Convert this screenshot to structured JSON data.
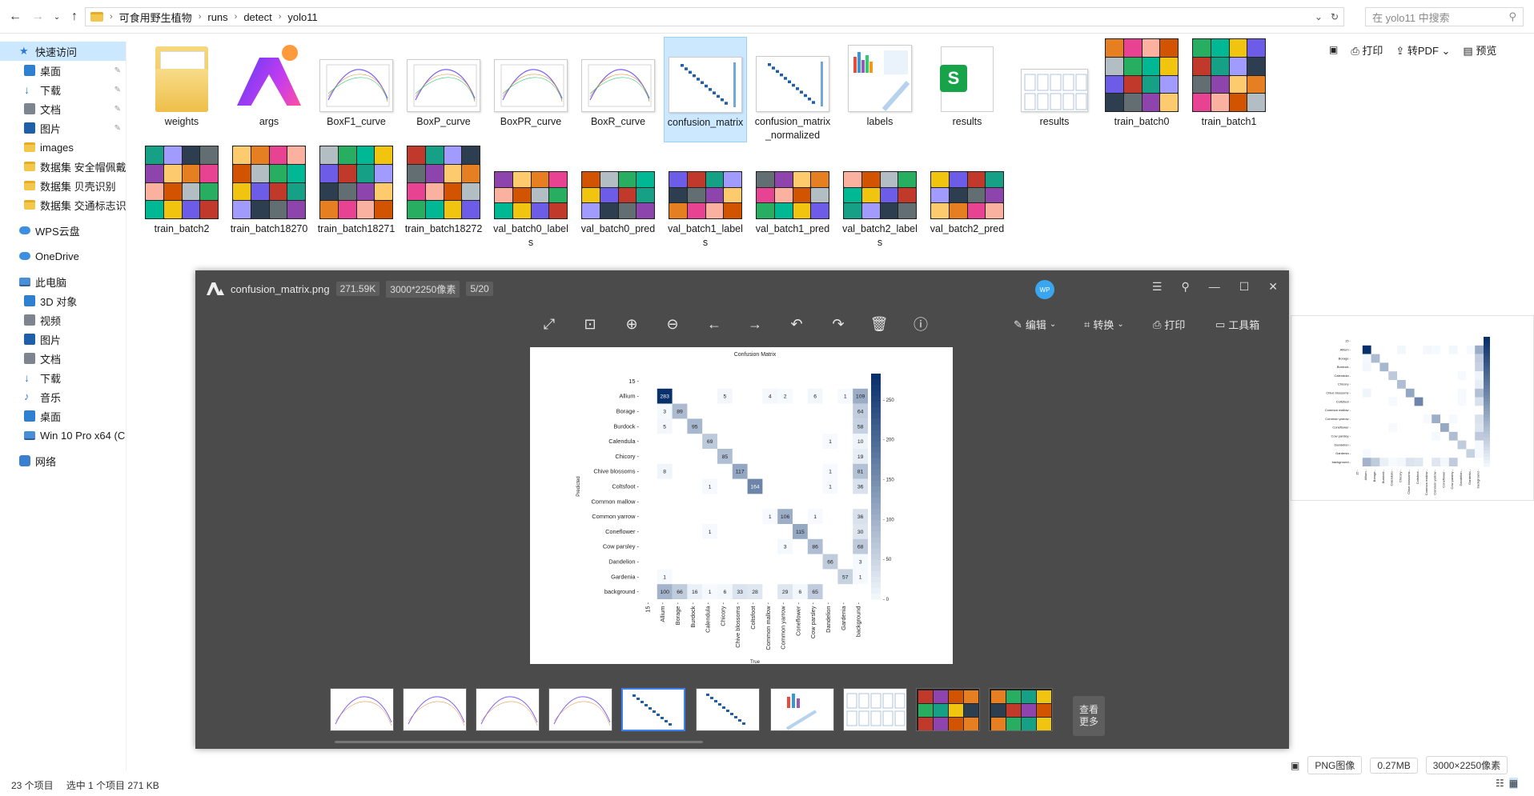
{
  "explorer": {
    "breadcrumb": [
      "可食用野生植物",
      "runs",
      "detect",
      "yolo11"
    ],
    "search_placeholder": "在 yolo11 中搜索",
    "toolbar": {
      "print": "打印",
      "to_pdf": "转PDF",
      "preview": "预览"
    }
  },
  "sidebar": {
    "quick_access": "快速访问",
    "items": [
      "桌面",
      "下载",
      "文档",
      "图片",
      "images",
      "数据集 安全帽佩戴",
      "数据集 贝壳识别",
      "数据集 交通标志识别"
    ],
    "wps": "WPS云盘",
    "onedrive": "OneDrive",
    "this_pc": "此电脑",
    "pc_items": [
      "3D 对象",
      "视频",
      "图片",
      "文档",
      "下载",
      "音乐",
      "桌面",
      "Win 10 Pro x64 (C:)"
    ],
    "network": "网络"
  },
  "files": [
    {
      "name": "weights",
      "type": "folder"
    },
    {
      "name": "args",
      "type": "ai"
    },
    {
      "name": "BoxF1_curve",
      "type": "chart"
    },
    {
      "name": "BoxP_curve",
      "type": "chart"
    },
    {
      "name": "BoxPR_curve",
      "type": "chart"
    },
    {
      "name": "BoxR_curve",
      "type": "chart"
    },
    {
      "name": "confusion_matrix",
      "type": "matrix",
      "selected": true
    },
    {
      "name": "confusion_matrix_normalized",
      "type": "matrix"
    },
    {
      "name": "labels",
      "type": "labels"
    },
    {
      "name": "results",
      "type": "sheet"
    },
    {
      "name": "results",
      "type": "resultsimg"
    },
    {
      "name": "train_batch0",
      "type": "photo"
    },
    {
      "name": "train_batch1",
      "type": "photo"
    },
    {
      "name": "train_batch2",
      "type": "photo"
    },
    {
      "name": "train_batch18270",
      "type": "photo"
    },
    {
      "name": "train_batch18271",
      "type": "photo"
    },
    {
      "name": "train_batch18272",
      "type": "photo"
    },
    {
      "name": "val_batch0_labels",
      "type": "photowide"
    },
    {
      "name": "val_batch0_pred",
      "type": "photowide"
    },
    {
      "name": "val_batch1_labels",
      "type": "photowide"
    },
    {
      "name": "val_batch1_pred",
      "type": "photowide"
    },
    {
      "name": "val_batch2_labels",
      "type": "photowide"
    },
    {
      "name": "val_batch2_pred",
      "type": "photowide"
    }
  ],
  "viewer": {
    "filename": "confusion_matrix.png",
    "size": "271.59K",
    "dims": "3000*2250像素",
    "index": "5/20",
    "avatar": "WP",
    "edit": "编辑",
    "convert": "转换",
    "print": "打印",
    "toolbox": "工具箱",
    "more": "查看更多"
  },
  "status": {
    "count": "23 个项目",
    "selected": "选中 1 个项目  271 KB",
    "format": "PNG图像",
    "filesize": "0.27MB",
    "dims": "3000×2250像素"
  },
  "chart_data": {
    "type": "heatmap",
    "title": "Confusion Matrix",
    "xlabel": "True",
    "ylabel": "Predicted",
    "labels": [
      "15",
      "Allium",
      "Borage",
      "Burdock",
      "Calendula",
      "Chicory",
      "Chive blossoms",
      "Coltsfoot",
      "Common mallow",
      "Common yarrow",
      "Coneflower",
      "Cow parsley",
      "Dandelion",
      "Gardenia",
      "background"
    ],
    "cells": [
      {
        "row": "Allium",
        "col": "Allium",
        "value": 283
      },
      {
        "row": "Allium",
        "col": "Chicory",
        "value": 5
      },
      {
        "row": "Allium",
        "col": "Common mallow",
        "value": 4
      },
      {
        "row": "Allium",
        "col": "Common yarrow",
        "value": 2
      },
      {
        "row": "Allium",
        "col": "Cow parsley",
        "value": 6
      },
      {
        "row": "Allium",
        "col": "Gardenia",
        "value": 1
      },
      {
        "row": "Allium",
        "col": "background",
        "value": 109
      },
      {
        "row": "Borage",
        "col": "Allium",
        "value": 3
      },
      {
        "row": "Borage",
        "col": "Borage",
        "value": 89
      },
      {
        "row": "Borage",
        "col": "background",
        "value": 64
      },
      {
        "row": "Burdock",
        "col": "Allium",
        "value": 5
      },
      {
        "row": "Burdock",
        "col": "Burdock",
        "value": 95
      },
      {
        "row": "Burdock",
        "col": "background",
        "value": 58
      },
      {
        "row": "Calendula",
        "col": "Calendula",
        "value": 69
      },
      {
        "row": "Calendula",
        "col": "Dandelion",
        "value": 1
      },
      {
        "row": "Calendula",
        "col": "background",
        "value": 10
      },
      {
        "row": "Chicory",
        "col": "Chicory",
        "value": 85
      },
      {
        "row": "Chicory",
        "col": "background",
        "value": 19
      },
      {
        "row": "Chive blossoms",
        "col": "Allium",
        "value": 8
      },
      {
        "row": "Chive blossoms",
        "col": "Chive blossoms",
        "value": 117
      },
      {
        "row": "Chive blossoms",
        "col": "Dandelion",
        "value": 1
      },
      {
        "row": "Chive blossoms",
        "col": "background",
        "value": 81
      },
      {
        "row": "Coltsfoot",
        "col": "Calendula",
        "value": 1
      },
      {
        "row": "Coltsfoot",
        "col": "Coltsfoot",
        "value": 164
      },
      {
        "row": "Coltsfoot",
        "col": "Dandelion",
        "value": 1
      },
      {
        "row": "Coltsfoot",
        "col": "background",
        "value": 36
      },
      {
        "row": "Common yarrow",
        "col": "Common mallow",
        "value": 1
      },
      {
        "row": "Common yarrow",
        "col": "Common yarrow",
        "value": 106
      },
      {
        "row": "Common yarrow",
        "col": "Cow parsley",
        "value": 1
      },
      {
        "row": "Common yarrow",
        "col": "background",
        "value": 36
      },
      {
        "row": "Coneflower",
        "col": "Calendula",
        "value": 1
      },
      {
        "row": "Coneflower",
        "col": "Coneflower",
        "value": 115
      },
      {
        "row": "Coneflower",
        "col": "background",
        "value": 30
      },
      {
        "row": "Cow parsley",
        "col": "Common yarrow",
        "value": 3
      },
      {
        "row": "Cow parsley",
        "col": "Cow parsley",
        "value": 86
      },
      {
        "row": "Cow parsley",
        "col": "background",
        "value": 68
      },
      {
        "row": "Dandelion",
        "col": "Dandelion",
        "value": 66
      },
      {
        "row": "Dandelion",
        "col": "background",
        "value": 3
      },
      {
        "row": "Gardenia",
        "col": "Allium",
        "value": 1
      },
      {
        "row": "Gardenia",
        "col": "Gardenia",
        "value": 57
      },
      {
        "row": "Gardenia",
        "col": "background",
        "value": 1
      },
      {
        "row": "background",
        "col": "Allium",
        "value": 100
      },
      {
        "row": "background",
        "col": "Borage",
        "value": 66
      },
      {
        "row": "background",
        "col": "Burdock",
        "value": 16
      },
      {
        "row": "background",
        "col": "Calendula",
        "value": 1
      },
      {
        "row": "background",
        "col": "Chicory",
        "value": 6
      },
      {
        "row": "background",
        "col": "Chive blossoms",
        "value": 33
      },
      {
        "row": "background",
        "col": "Coltsfoot",
        "value": 28
      },
      {
        "row": "background",
        "col": "Common yarrow",
        "value": 29
      },
      {
        "row": "background",
        "col": "Coneflower",
        "value": 6
      },
      {
        "row": "background",
        "col": "Cow parsley",
        "value": 65
      }
    ],
    "colorbar_ticks": [
      0,
      50,
      100,
      150,
      200,
      250
    ],
    "vmax": 283
  }
}
